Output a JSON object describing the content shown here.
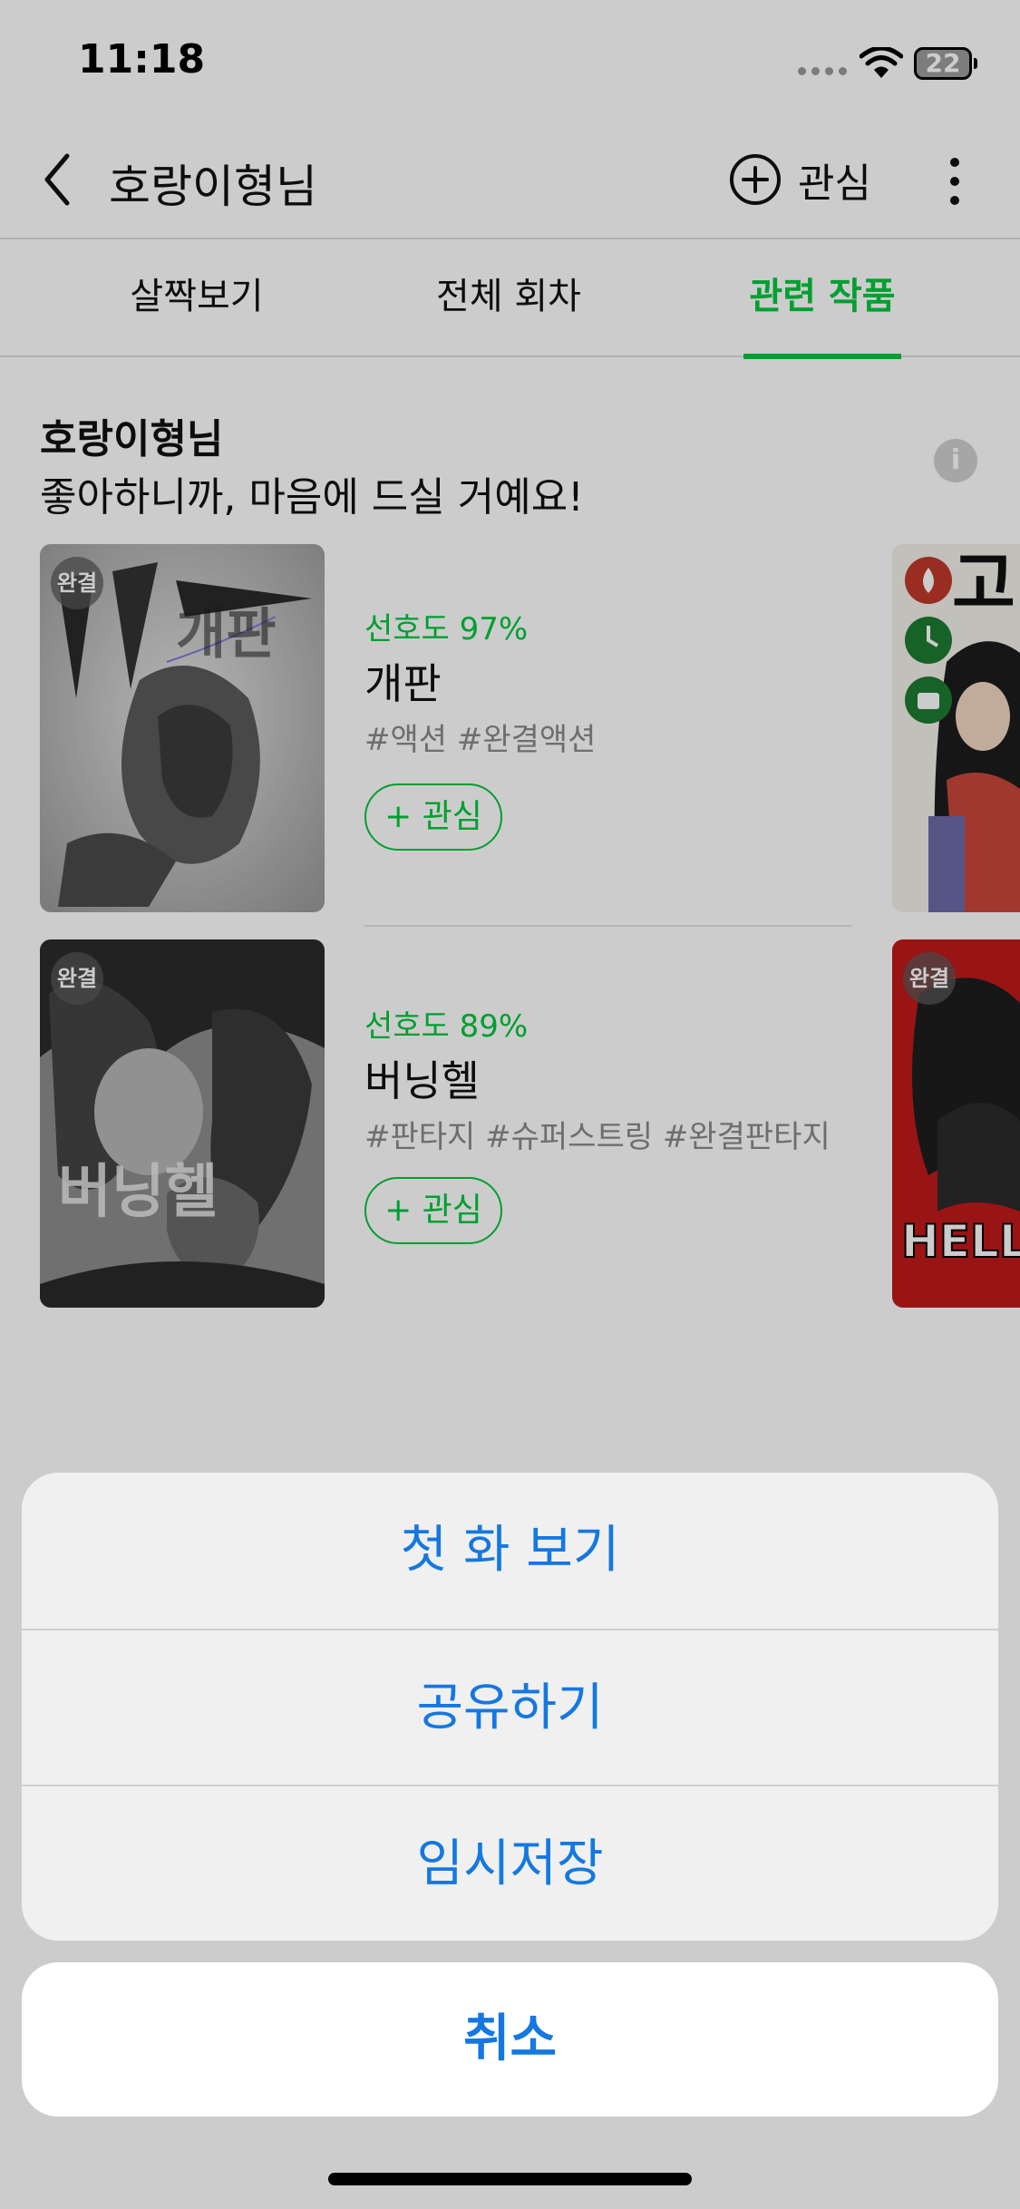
{
  "status_bar": {
    "time": "11:18",
    "battery": "22"
  },
  "header": {
    "title": "호랑이형님",
    "follow_label": "관심"
  },
  "tabs": [
    {
      "label": "살짝보기",
      "active": false
    },
    {
      "label": "전체 회차",
      "active": false
    },
    {
      "label": "관련 작품",
      "active": true
    }
  ],
  "section": {
    "title": "호랑이형님",
    "subtitle": "좋아하니까, 마음에 드실 거예요!",
    "info_icon": "i"
  },
  "works": [
    {
      "badge": "완결",
      "preference": "선호도 97%",
      "title": "개판",
      "tags": "#액션 #완결액션",
      "follow_label": "+ 관심",
      "cover_text": "개판"
    },
    {
      "badge": "완결",
      "preference": "선호도 89%",
      "title": "버닝헬",
      "tags": "#판타지 #슈퍼스트링 #완결판타지",
      "follow_label": "+ 관심",
      "cover_text": "버닝헬"
    }
  ],
  "peek_cards": [
    {
      "badge": "",
      "cover_text": "고"
    },
    {
      "badge": "완결",
      "cover_text": "HELL"
    }
  ],
  "action_sheet": {
    "items": [
      "첫 화 보기",
      "공유하기",
      "임시저장"
    ],
    "cancel_label": "취소"
  },
  "colors": {
    "accent_green": "#00c73c",
    "action_blue": "#1478e0"
  }
}
